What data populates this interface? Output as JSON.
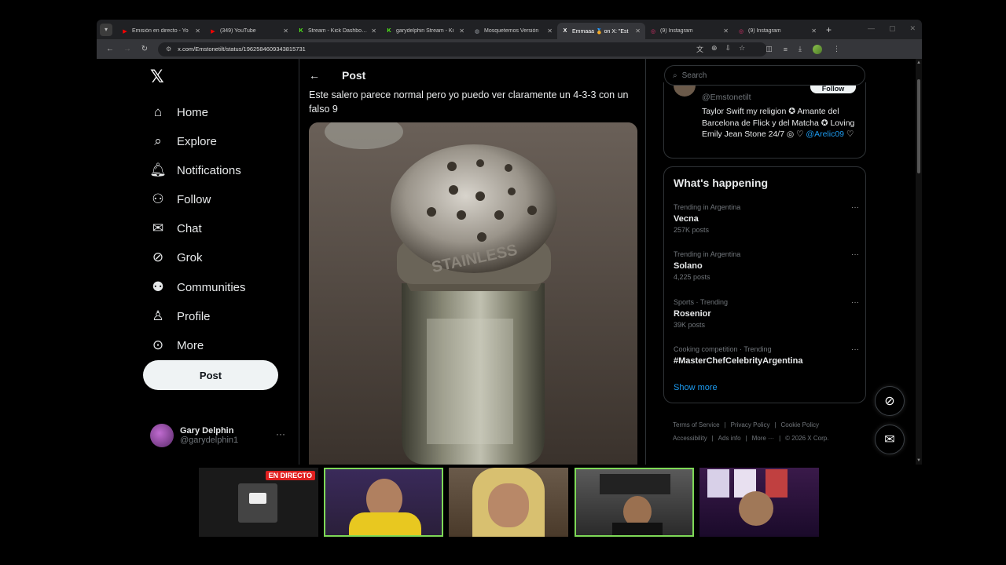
{
  "browser": {
    "tabs": [
      {
        "title": "Emisión en directo - Yo",
        "icon": "youtube-icon",
        "color": "#ff0000",
        "active": false
      },
      {
        "title": "(349) YouTube",
        "icon": "youtube-icon",
        "color": "#ff0000",
        "active": false
      },
      {
        "title": "Stream - Kick Dashboard",
        "icon": "kick-icon",
        "color": "#53fc18",
        "active": false
      },
      {
        "title": "garydelphin Stream - Ki",
        "icon": "kick-icon",
        "color": "#53fc18",
        "active": false
      },
      {
        "title": "Mosquetemos Versión",
        "icon": "globe-icon",
        "color": "#9aa0a6",
        "active": false
      },
      {
        "title": "Emmaaa 🏅 on X: \"Est",
        "icon": "x-icon",
        "color": "#ffffff",
        "active": true
      },
      {
        "title": "(9) Instagram",
        "icon": "instagram-icon",
        "color": "#e1306c",
        "active": false
      },
      {
        "title": "(9) Instagram",
        "icon": "instagram-icon",
        "color": "#e1306c",
        "active": false
      }
    ],
    "url": "x.com/Emstonetilt/status/1962584609343815731"
  },
  "nav": {
    "items": [
      {
        "label": "Home",
        "icon": "home-icon"
      },
      {
        "label": "Explore",
        "icon": "search-icon"
      },
      {
        "label": "Notifications",
        "icon": "bell-icon"
      },
      {
        "label": "Follow",
        "icon": "add-user-icon"
      },
      {
        "label": "Chat",
        "icon": "mail-icon"
      },
      {
        "label": "Grok",
        "icon": "grok-icon"
      },
      {
        "label": "Communities",
        "icon": "communities-icon"
      },
      {
        "label": "Profile",
        "icon": "person-icon"
      },
      {
        "label": "More",
        "icon": "more-circle-icon"
      }
    ],
    "post_label": "Post",
    "account": {
      "name": "Gary Delphin",
      "handle": "@garydelphin1"
    }
  },
  "post": {
    "header": "Post",
    "text": "Este salero parece normal pero yo puedo ver claramente un 4-3-3 con un falso 9",
    "media_shaker_text": "STAINLESS"
  },
  "sidebar": {
    "search_placeholder": "Search",
    "profile": {
      "handle": "@Emstonetilt",
      "follow_label": "Follow",
      "bio": "Taylor Swift my religion ✪ Amante del Barcelona de Flick y del Matcha ✪ Loving Emily Jean Stone 24/7 ◎ ♡",
      "mention": "@Arelic09",
      "mention_suffix": " ♡"
    },
    "happening_title": "What's happening",
    "trends": [
      {
        "meta": "Trending in Argentina",
        "name": "Vecna",
        "count": "257K posts"
      },
      {
        "meta": "Trending in Argentina",
        "name": "Solano",
        "count": "4,225 posts"
      },
      {
        "meta": "Sports · Trending",
        "name": "Rosenior",
        "count": "39K posts"
      },
      {
        "meta": "Cooking competition · Trending",
        "name": "#MasterChefCelebrityArgentina",
        "count": ""
      }
    ],
    "show_more": "Show more",
    "footer": [
      "Terms of Service",
      "Privacy Policy",
      "Cookie Policy",
      "Accessibility",
      "Ads info",
      "More ···",
      "© 2026 X Corp."
    ]
  },
  "stream": {
    "live_badge": "EN DIRECTO"
  }
}
